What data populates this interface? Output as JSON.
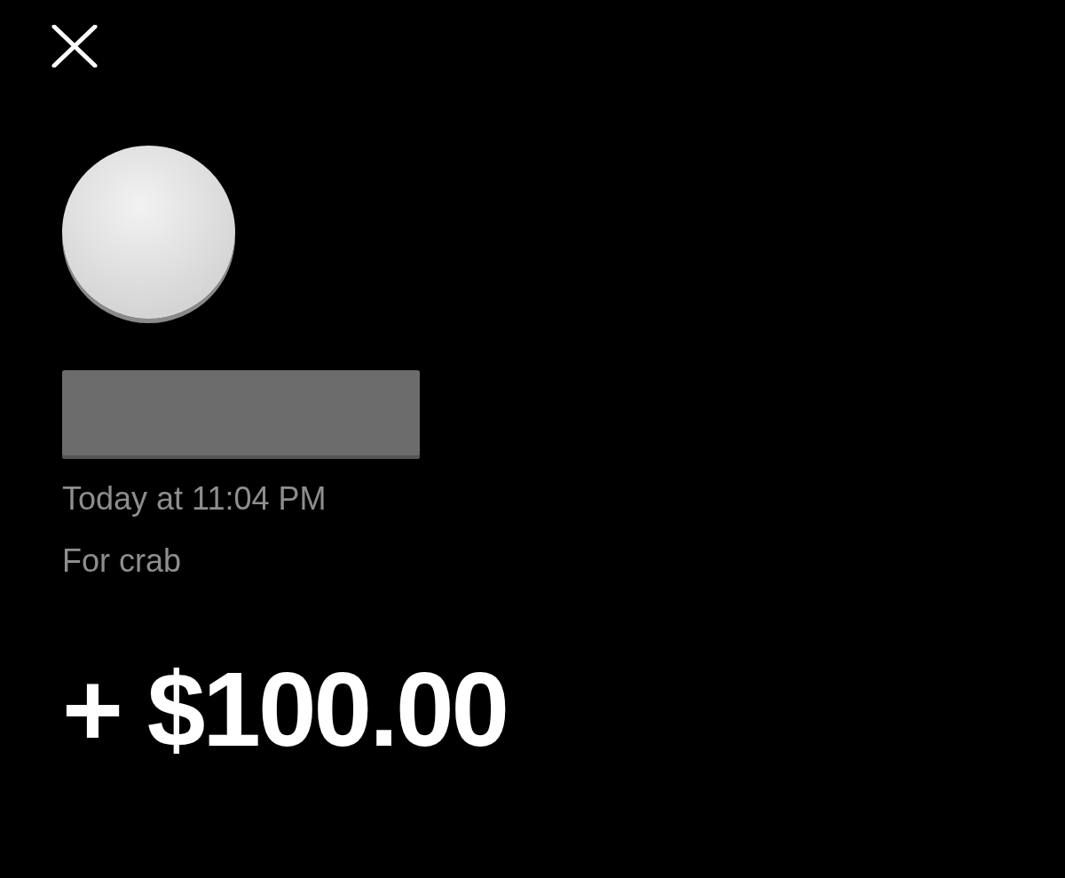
{
  "transaction": {
    "date": "Today at 11:04 PM",
    "note": "For crab",
    "amount": "+ $100.00"
  }
}
